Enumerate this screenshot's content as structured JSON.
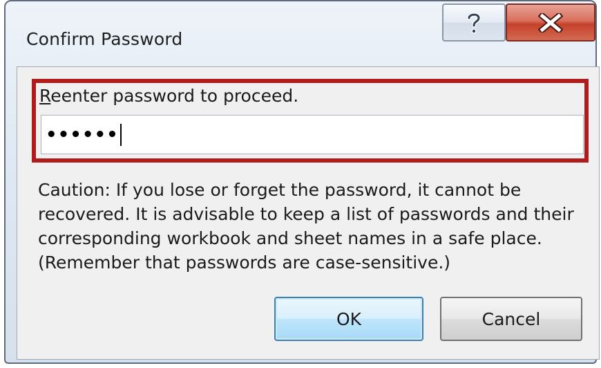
{
  "window": {
    "title": "Confirm Password"
  },
  "titlebar": {
    "help_icon": "question-mark-icon",
    "close_icon": "close-x-icon"
  },
  "form": {
    "label_accel": "R",
    "label_rest": "eenter password to proceed.",
    "password_value": "••••••"
  },
  "caution": {
    "text": "Caution: If you lose or forget the password, it cannot be recovered. It is advisable to keep a list of passwords and their corresponding workbook and sheet names in a safe place.  (Remember that passwords are case-sensitive.)"
  },
  "buttons": {
    "ok_label": "OK",
    "cancel_label": "Cancel"
  },
  "colors": {
    "highlight_border": "#b01c1c",
    "close_button": "#c4412a",
    "default_button_border": "#3c7fb1"
  }
}
